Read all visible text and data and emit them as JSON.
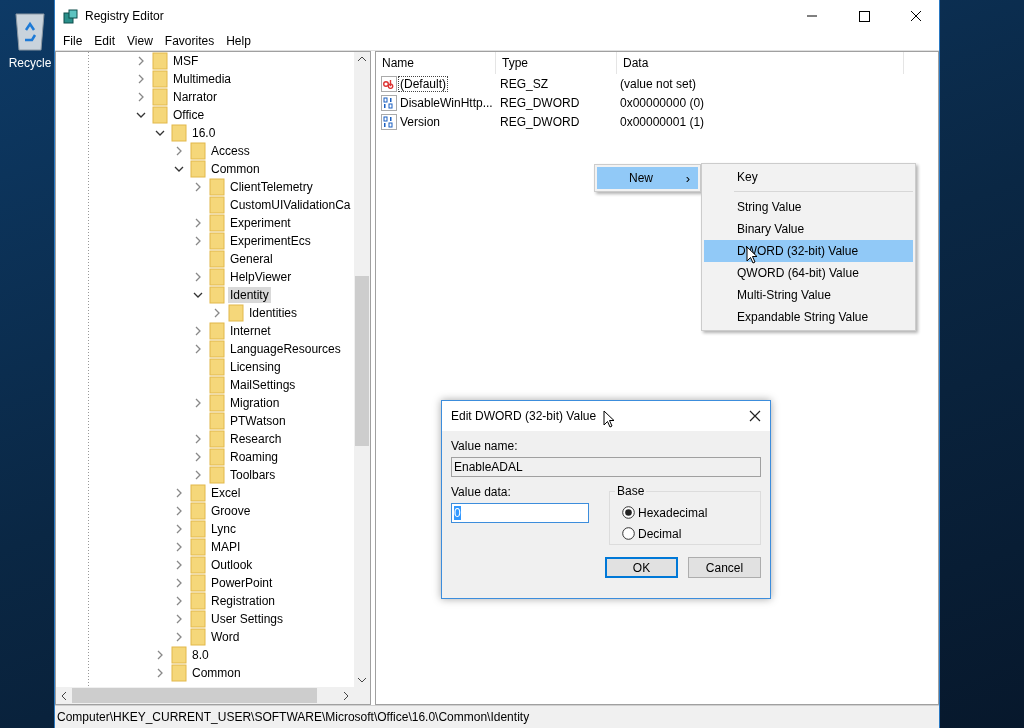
{
  "desktop": {
    "icons": [
      {
        "label": "Recycle"
      }
    ]
  },
  "window": {
    "title": "Registry Editor"
  },
  "menu": [
    "File",
    "Edit",
    "View",
    "Favorites",
    "Help"
  ],
  "tree": {
    "items": [
      {
        "label": "MSF",
        "kind": "branch",
        "expanded": false,
        "selected": false
      },
      {
        "label": "Multimedia",
        "kind": "branch",
        "expanded": false,
        "selected": false
      },
      {
        "label": "Narrator",
        "kind": "branch",
        "expanded": false,
        "selected": false
      },
      {
        "label": "Office",
        "kind": "branch",
        "expanded": true,
        "selected": false,
        "children": [
          {
            "label": "16.0",
            "kind": "branch",
            "expanded": true,
            "selected": false,
            "children": [
              {
                "label": "Access",
                "kind": "branch",
                "expanded": false,
                "selected": false
              },
              {
                "label": "Common",
                "kind": "branch",
                "expanded": true,
                "selected": false,
                "children": [
                  {
                    "label": "ClientTelemetry",
                    "kind": "branch",
                    "expanded": false,
                    "selected": false
                  },
                  {
                    "label": "CustomUIValidationCa",
                    "kind": "leaf",
                    "selected": false
                  },
                  {
                    "label": "Experiment",
                    "kind": "branch",
                    "expanded": false,
                    "selected": false
                  },
                  {
                    "label": "ExperimentEcs",
                    "kind": "branch",
                    "expanded": false,
                    "selected": false
                  },
                  {
                    "label": "General",
                    "kind": "leaf",
                    "selected": false
                  },
                  {
                    "label": "HelpViewer",
                    "kind": "branch",
                    "expanded": false,
                    "selected": false
                  },
                  {
                    "label": "Identity",
                    "kind": "branch",
                    "expanded": true,
                    "selected": true,
                    "children": [
                      {
                        "label": "Identities",
                        "kind": "branch",
                        "expanded": false,
                        "selected": false
                      }
                    ]
                  },
                  {
                    "label": "Internet",
                    "kind": "branch",
                    "expanded": false,
                    "selected": false
                  },
                  {
                    "label": "LanguageResources",
                    "kind": "branch",
                    "expanded": false,
                    "selected": false
                  },
                  {
                    "label": "Licensing",
                    "kind": "leaf",
                    "selected": false
                  },
                  {
                    "label": "MailSettings",
                    "kind": "leaf",
                    "selected": false
                  },
                  {
                    "label": "Migration",
                    "kind": "branch",
                    "expanded": false,
                    "selected": false
                  },
                  {
                    "label": "PTWatson",
                    "kind": "leaf",
                    "selected": false
                  },
                  {
                    "label": "Research",
                    "kind": "branch",
                    "expanded": false,
                    "selected": false
                  },
                  {
                    "label": "Roaming",
                    "kind": "branch",
                    "expanded": false,
                    "selected": false
                  },
                  {
                    "label": "Toolbars",
                    "kind": "branch",
                    "expanded": false,
                    "selected": false
                  }
                ]
              },
              {
                "label": "Excel",
                "kind": "branch",
                "expanded": false,
                "selected": false
              },
              {
                "label": "Groove",
                "kind": "branch",
                "expanded": false,
                "selected": false
              },
              {
                "label": "Lync",
                "kind": "branch",
                "expanded": false,
                "selected": false
              },
              {
                "label": "MAPI",
                "kind": "branch",
                "expanded": false,
                "selected": false
              },
              {
                "label": "Outlook",
                "kind": "branch",
                "expanded": false,
                "selected": false
              },
              {
                "label": "PowerPoint",
                "kind": "branch",
                "expanded": false,
                "selected": false
              },
              {
                "label": "Registration",
                "kind": "branch",
                "expanded": false,
                "selected": false
              },
              {
                "label": "User Settings",
                "kind": "branch",
                "expanded": false,
                "selected": false
              },
              {
                "label": "Word",
                "kind": "branch",
                "expanded": false,
                "selected": false
              }
            ]
          },
          {
            "label": "8.0",
            "kind": "branch",
            "expanded": false,
            "selected": false
          },
          {
            "label": "Common",
            "kind": "branch",
            "expanded": false,
            "selected": false
          }
        ]
      }
    ]
  },
  "values": {
    "columns": [
      "Name",
      "Type",
      "Data"
    ],
    "rows": [
      {
        "name": "(Default)",
        "type": "REG_SZ",
        "data": "(value not set)",
        "kind": "string",
        "focused": true
      },
      {
        "name": "DisableWinHttp...",
        "type": "REG_DWORD",
        "data": "0x00000000 (0)",
        "kind": "binary",
        "focused": false
      },
      {
        "name": "Version",
        "type": "REG_DWORD",
        "data": "0x00000001 (1)",
        "kind": "binary",
        "focused": false
      }
    ]
  },
  "context_menu": {
    "items": [
      {
        "label": "New",
        "arrow": "›",
        "selected": true
      }
    ],
    "submenu": {
      "groups": [
        [
          {
            "label": "Key",
            "selected": false
          }
        ],
        [
          {
            "label": "String Value",
            "selected": false
          },
          {
            "label": "Binary Value",
            "selected": false
          },
          {
            "label": "DWORD (32-bit) Value",
            "selected": true
          },
          {
            "label": "QWORD (64-bit) Value",
            "selected": false
          },
          {
            "label": "Multi-String Value",
            "selected": false
          },
          {
            "label": "Expandable String Value",
            "selected": false
          }
        ]
      ]
    }
  },
  "dialog": {
    "title": "Edit DWORD (32-bit) Value",
    "value_name_label": "Value name:",
    "value_name": "EnableADAL",
    "value_data_label": "Value data:",
    "value_data": "0",
    "base": {
      "label": "Base",
      "options": [
        {
          "label": "Hexadecimal",
          "selected": true
        },
        {
          "label": "Decimal",
          "selected": false
        }
      ]
    },
    "buttons": [
      {
        "label": "OK",
        "default": true
      },
      {
        "label": "Cancel",
        "default": false
      }
    ]
  },
  "status_bar": "Computer\\HKEY_CURRENT_USER\\SOFTWARE\\Microsoft\\Office\\16.0\\Common\\Identity"
}
